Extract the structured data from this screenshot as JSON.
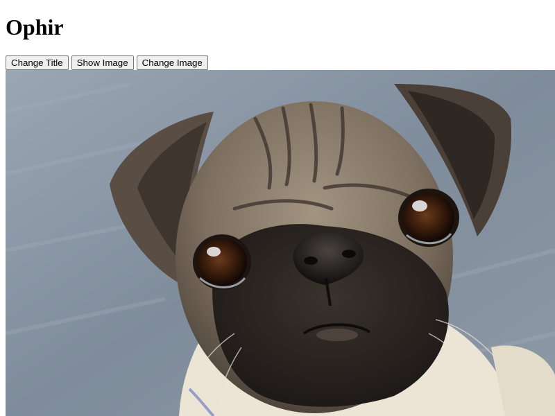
{
  "page": {
    "title": "Ophir"
  },
  "toolbar": {
    "buttons": [
      {
        "label": "Change Title"
      },
      {
        "label": "Show Image"
      },
      {
        "label": "Change Image"
      }
    ]
  },
  "image": {
    "subject": "pug-dog-photo",
    "colors": {
      "background": "#8a97a6",
      "fur": "#8b7d6e",
      "mask": "#2b2622",
      "chest": "#ece5d6"
    }
  }
}
